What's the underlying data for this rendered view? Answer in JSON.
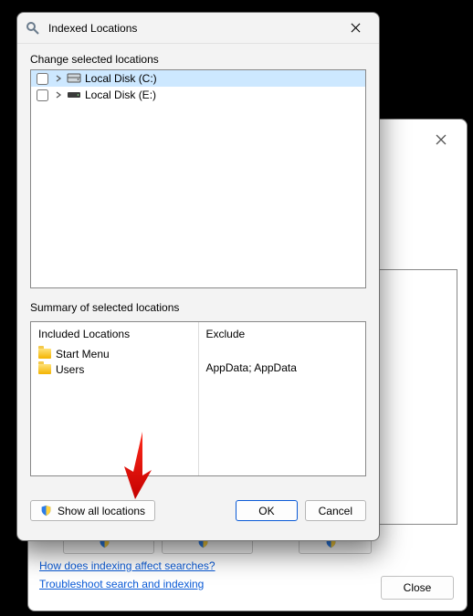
{
  "front": {
    "title": "Indexed Locations",
    "change_label": "Change selected locations",
    "tree": [
      {
        "label": "Local Disk (C:)",
        "selected": true,
        "icon": "hdd"
      },
      {
        "label": "Local Disk (E:)",
        "selected": false,
        "icon": "drive"
      }
    ],
    "summary_label": "Summary of selected locations",
    "summary": {
      "included_header": "Included Locations",
      "exclude_header": "Exclude",
      "included": [
        "Start Menu",
        "Users"
      ],
      "exclude_text": "AppData; AppData"
    },
    "buttons": {
      "show_all": "Show all locations",
      "ok": "OK",
      "cancel": "Cancel"
    }
  },
  "back": {
    "ghost_buttons": [
      "   ",
      "   ",
      "   "
    ],
    "help_links": [
      "How does indexing affect searches?",
      "Troubleshoot search and indexing"
    ],
    "close": "Close"
  }
}
